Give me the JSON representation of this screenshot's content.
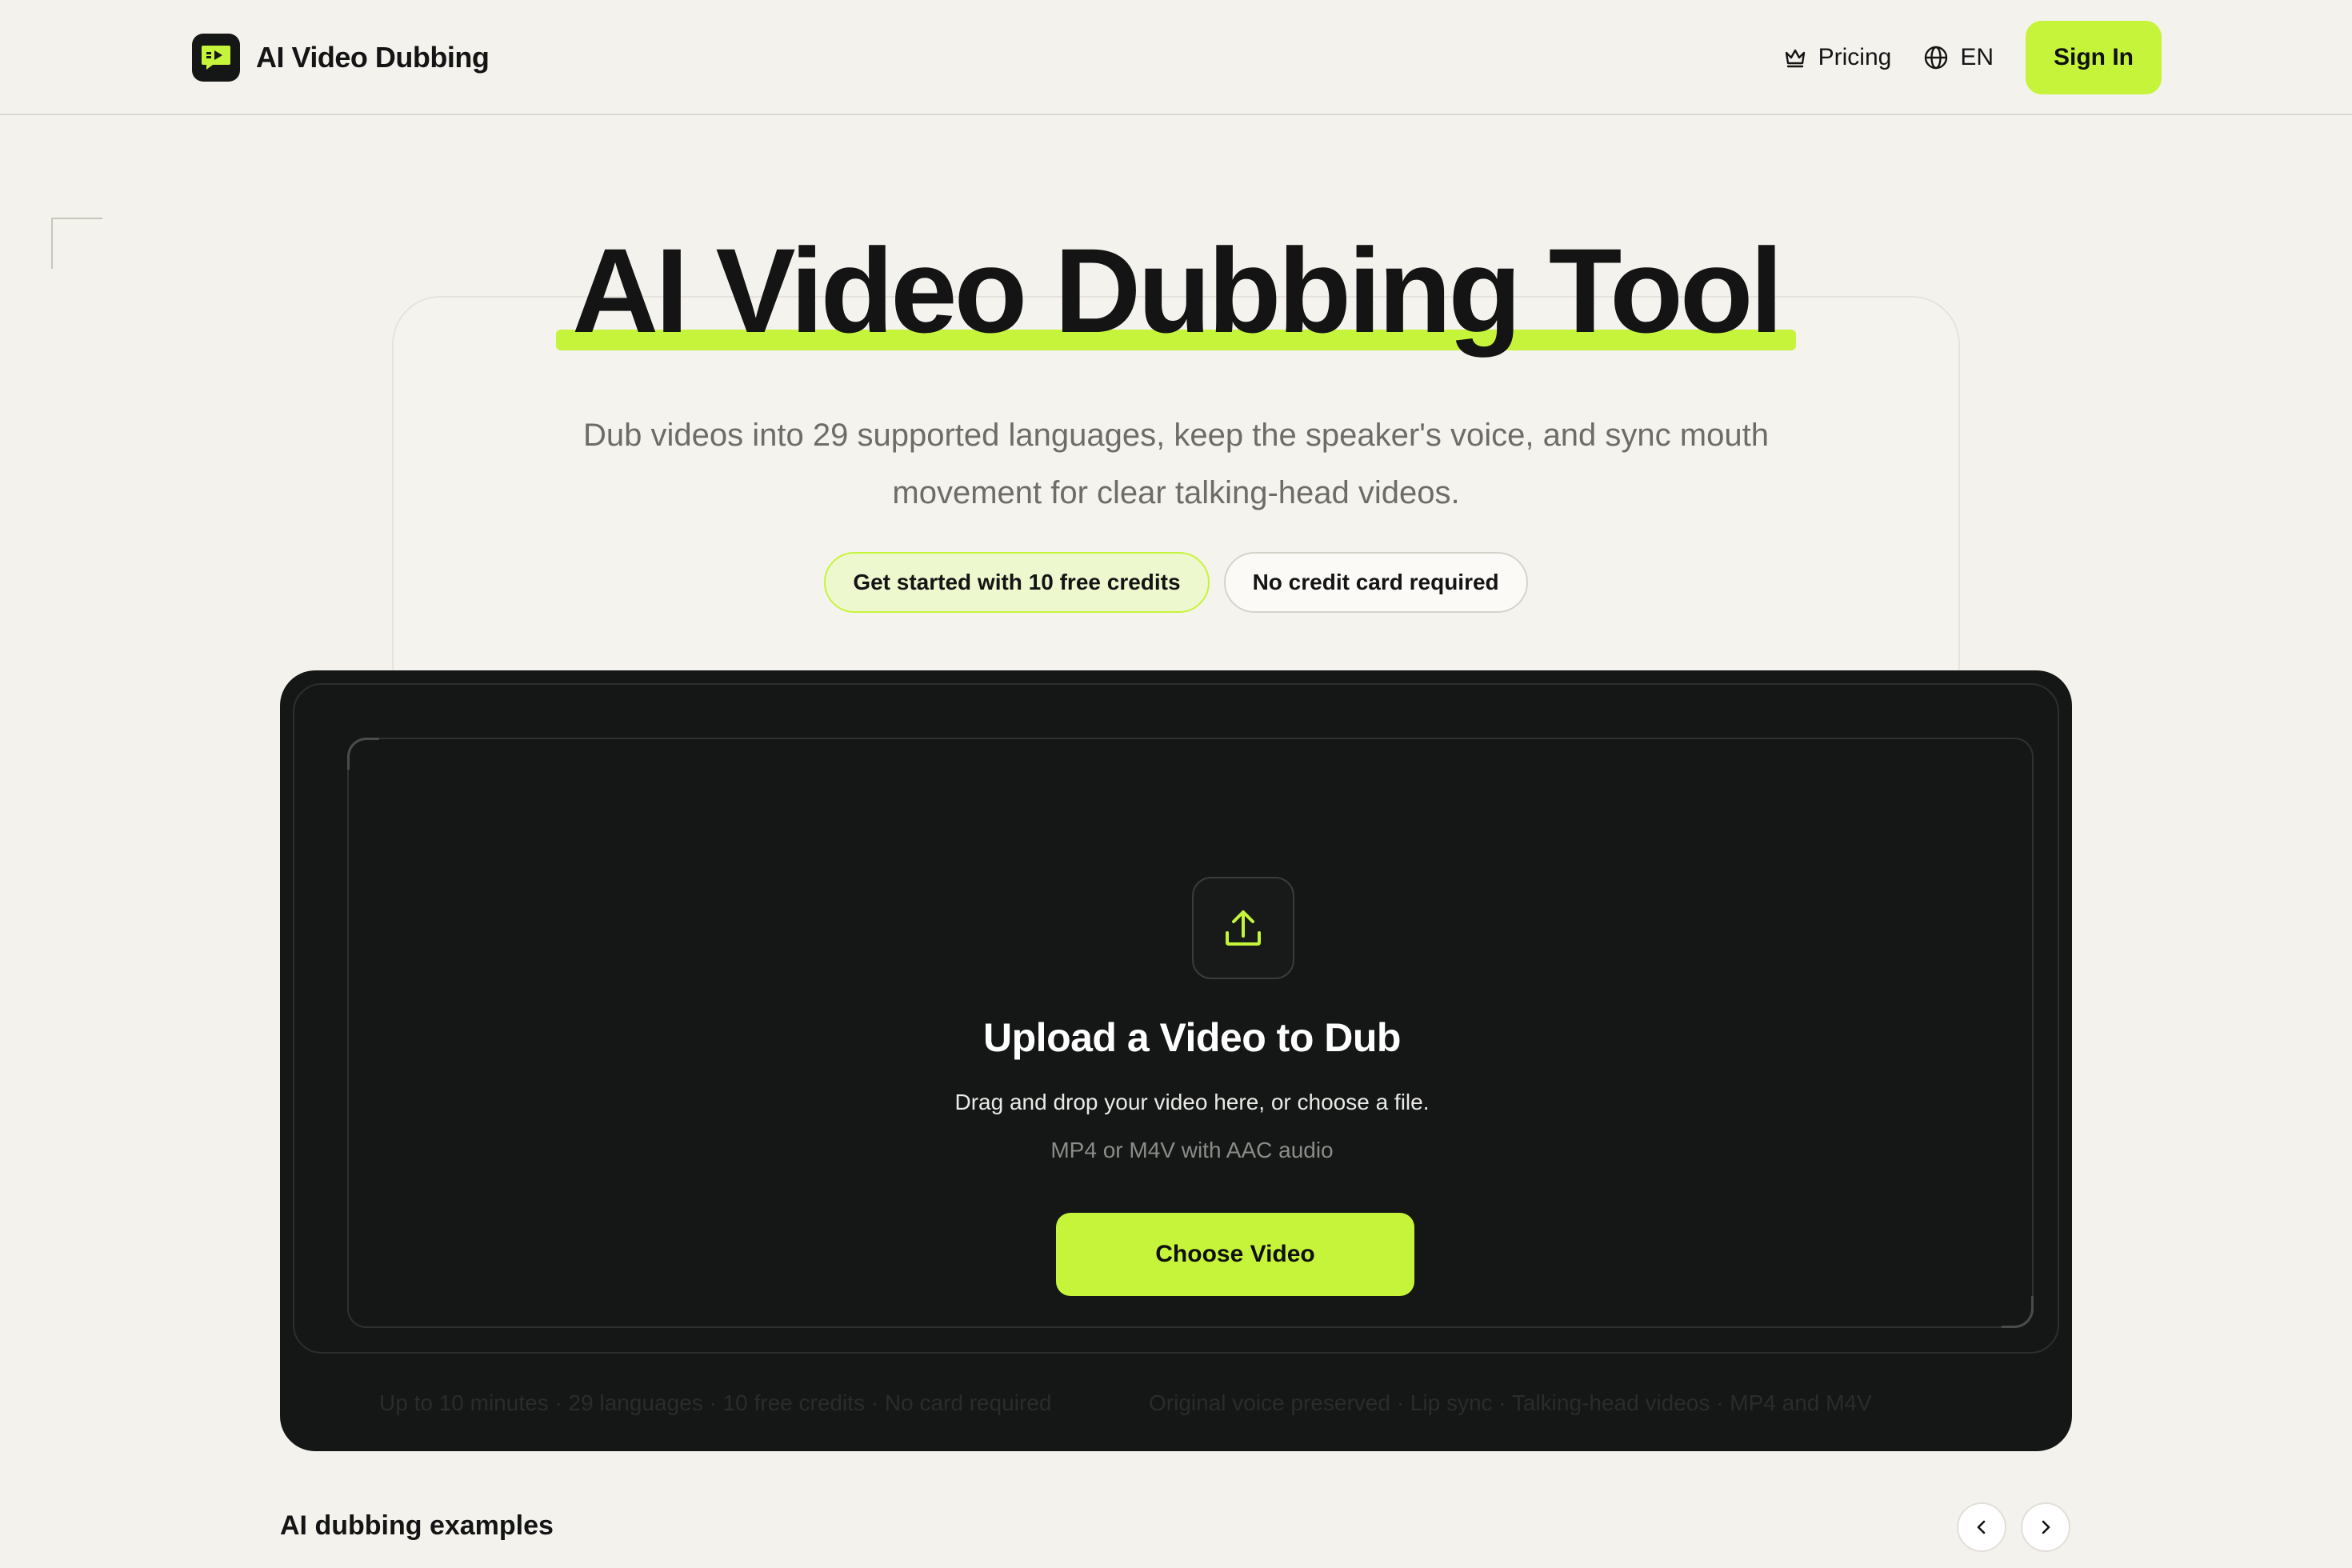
{
  "header": {
    "brand_name": "AI Video Dubbing",
    "nav": {
      "pricing": "Pricing",
      "language": "EN",
      "sign_in": "Sign In"
    }
  },
  "hero": {
    "title": "AI Video Dubbing Tool",
    "subtitle": "Dub videos into 29 supported languages, keep the speaker's voice, and sync mouth movement for clear talking-head videos.",
    "pills": {
      "free_credits": "Get started with 10 free credits",
      "no_card": "No credit card required"
    }
  },
  "upload": {
    "title": "Upload a Video to Dub",
    "description": "Drag and drop your video here, or choose a file.",
    "formats": "MP4 or M4V with AAC audio",
    "button": "Choose Video",
    "ticker_left": "Up to 10 minutes · 29 languages · 10 free credits · No card required",
    "ticker_right": "Original voice preserved · Lip sync · Talking-head videos · MP4 and M4V"
  },
  "examples": {
    "title": "AI dubbing examples"
  },
  "colors": {
    "accent": "#c6f43b",
    "dark_panel": "#151716",
    "background": "#f4f2ec"
  },
  "icons": {
    "logo": "video-dub-logo-icon",
    "pricing": "crown-icon",
    "language": "globe-icon",
    "upload": "upload-icon",
    "prev": "chevron-left-icon",
    "next": "chevron-right-icon"
  }
}
